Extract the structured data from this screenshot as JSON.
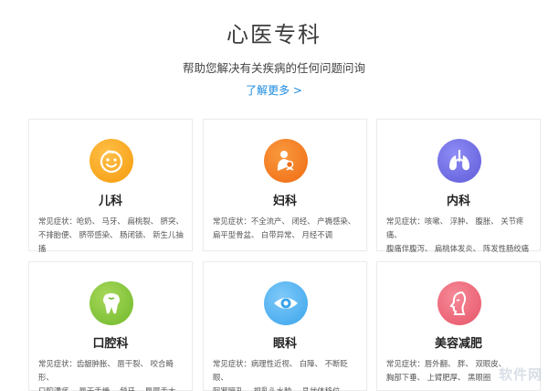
{
  "header": {
    "title": "心医专科",
    "subtitle": "帮助您解决有关疾病的任何问题问询",
    "more_link": "了解更多 >"
  },
  "cards": [
    {
      "name": "儿科",
      "icon": "child-face-icon",
      "color": "#f5a623",
      "symptoms": "常见症状：呛奶、 马牙、 扁桃裂、 脐突、\n不排胎便、 脐带感染、 肠闭锁、 新生儿抽搐"
    },
    {
      "name": "妇科",
      "icon": "mother-baby-icon",
      "color": "#f07a1a",
      "symptoms": "常见症状：不全流产、 闭经、 产褥感染、\n扁平型骨盆、 白带异常、 月经不调"
    },
    {
      "name": "内科",
      "icon": "lungs-icon",
      "color": "#6c66e0",
      "symptoms": "常见症状：咳嗽、 浮肿、 腹胀、 关节疼痛、\n腹痛伴腹泻、 扁桃体发炎、 阵发性肠绞痛"
    },
    {
      "name": "口腔科",
      "icon": "tooth-icon",
      "color": "#7cbf32",
      "symptoms": "常见症状：齿龈肿胀、 唇干裂、 咬合畸形、\n口腔溃疡、 唇干舌燥、 龋牙、 唇厚舌大"
    },
    {
      "name": "眼科",
      "icon": "eye-icon",
      "color": "#3ea7ee",
      "symptoms": "常见症状：病理性近视、 白障、 不断眨眼、\n阿罗瞳孔、 视乳头水肿、 晶状体移位"
    },
    {
      "name": "美容减肥",
      "icon": "face-profile-icon",
      "color": "#e85d6f",
      "symptoms": "常见症状：唇外翻、 胖、 双眼皮、\n胸部下垂、 上臂肥厚、 黑眼圈"
    }
  ]
}
